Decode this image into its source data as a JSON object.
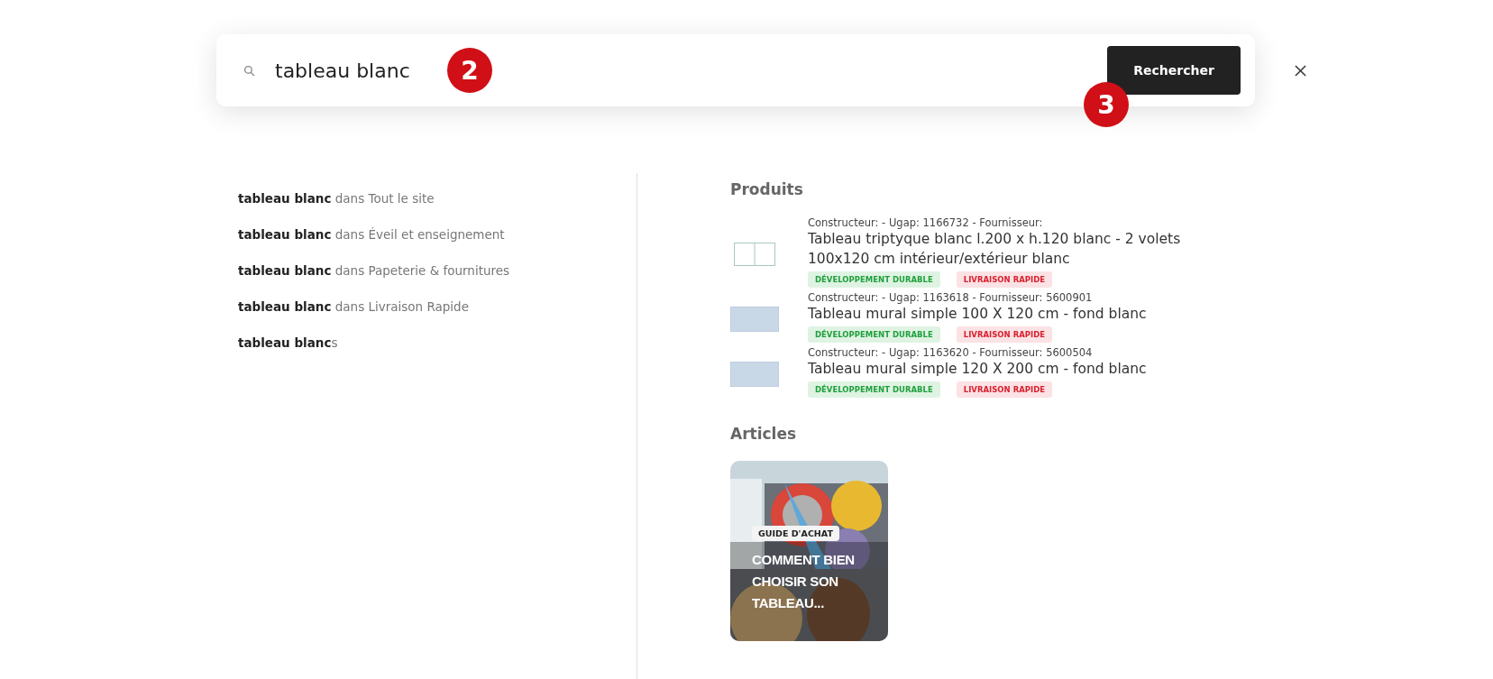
{
  "search": {
    "value": "tableau blanc",
    "button": "Rechercher",
    "markers": [
      "2",
      "3"
    ]
  },
  "suggestions": [
    {
      "text": "**tableau blanc** dans Tout le site"
    },
    {
      "text": "**tableau blanc** dans Éveil et enseignement"
    },
    {
      "text": "**tableau blanc** dans Papeterie & fournitures"
    },
    {
      "text": "**tableau blanc** dans Livraison Rapide"
    },
    {
      "text": "**tableau blanc**s"
    }
  ],
  "products": {
    "heading": "Produits",
    "items": [
      {
        "meta": "Constructeur: - Ugap: 1166732 - Fournisseur:",
        "title": "Tableau triptyque blanc l.200 x h.120 blanc - 2 volets 100x120 cm intérieur/extérieur blanc",
        "kind": "triptych",
        "tags": [
          {
            "label": "DÉVELOPPEMENT DURABLE",
            "kind": "eco"
          },
          {
            "label": "LIVRAISON RAPIDE",
            "kind": "fast"
          }
        ]
      },
      {
        "meta": "Constructeur: - Ugap: 1163618 - Fournisseur: 5600901",
        "title": "Tableau mural simple 100 X 120 cm - fond blanc",
        "kind": "board",
        "tags": [
          {
            "label": "DÉVELOPPEMENT DURABLE",
            "kind": "eco"
          },
          {
            "label": "LIVRAISON RAPIDE",
            "kind": "fast"
          }
        ]
      },
      {
        "meta": "Constructeur: - Ugap: 1163620 - Fournisseur: 5600504",
        "title": "Tableau mural simple 120 X 200 cm - fond blanc",
        "kind": "board",
        "tags": [
          {
            "label": "DÉVELOPPEMENT DURABLE",
            "kind": "eco"
          },
          {
            "label": "LIVRAISON RAPIDE",
            "kind": "fast"
          }
        ]
      }
    ]
  },
  "articles": {
    "heading": "Articles",
    "items": [
      {
        "badge": "GUIDE D'ACHAT",
        "title": "COMMENT BIEN CHOISIR SON TABLEAU..."
      }
    ]
  }
}
